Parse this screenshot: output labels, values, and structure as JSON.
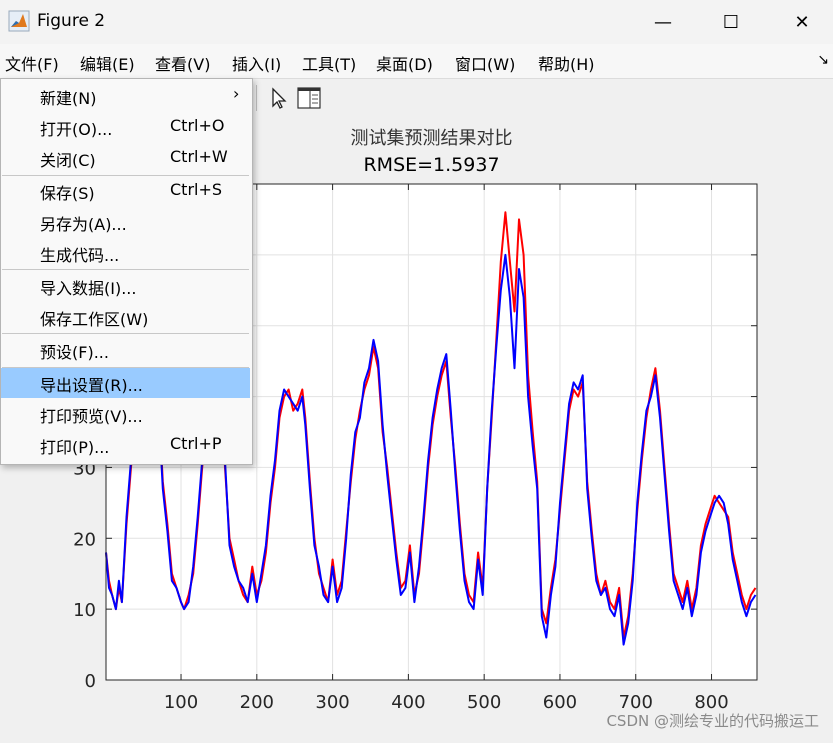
{
  "window": {
    "title": "Figure 2",
    "minimize_glyph": "—",
    "maximize_glyph": "☐",
    "close_glyph": "✕"
  },
  "menubar": {
    "items": [
      "文件(F)",
      "编辑(E)",
      "查看(V)",
      "插入(I)",
      "工具(T)",
      "桌面(D)",
      "窗口(W)",
      "帮助(H)"
    ],
    "overflow_glyph": "↘"
  },
  "toolbar": {
    "icons": [
      "pointer-icon",
      "property-inspector-icon"
    ]
  },
  "file_menu": {
    "items": [
      {
        "label": "新建(N)",
        "shortcut": "",
        "submenu": true
      },
      {
        "label": "打开(O)...",
        "shortcut": "Ctrl+O"
      },
      {
        "label": "关闭(C)",
        "shortcut": "Ctrl+W"
      },
      {
        "label": "保存(S)",
        "shortcut": "Ctrl+S"
      },
      {
        "label": "另存为(A)...",
        "shortcut": ""
      },
      {
        "label": "生成代码...",
        "shortcut": ""
      },
      {
        "label": "导入数据(I)...",
        "shortcut": ""
      },
      {
        "label": "保存工作区(W)",
        "shortcut": ""
      },
      {
        "label": "预设(F)...",
        "shortcut": ""
      },
      {
        "label": "导出设置(R)...",
        "shortcut": "",
        "highlighted": true
      },
      {
        "label": "打印预览(V)...",
        "shortcut": ""
      },
      {
        "label": "打印(P)...",
        "shortcut": "Ctrl+P"
      }
    ],
    "submenu_glyph": "›"
  },
  "chart_data": {
    "type": "line",
    "title": "测试集预测结果对比",
    "subtitle": "RMSE=1.5937",
    "xlabel": "",
    "ylabel": "",
    "xlim": [
      1,
      860
    ],
    "ylim": [
      0,
      70
    ],
    "xticks": [
      100,
      200,
      300,
      400,
      500,
      600,
      700,
      800
    ],
    "yticks_visible": [
      0,
      10,
      20,
      30
    ],
    "grid": true,
    "series": [
      {
        "color": "#ff0000",
        "x": [
          1,
          5,
          9,
          14,
          18,
          22,
          28,
          34,
          40,
          46,
          52,
          58,
          64,
          70,
          76,
          82,
          88,
          94,
          100,
          104,
          110,
          116,
          122,
          128,
          134,
          140,
          146,
          152,
          158,
          164,
          170,
          176,
          182,
          188,
          194,
          200,
          206,
          212,
          218,
          224,
          230,
          236,
          242,
          248,
          254,
          260,
          264,
          270,
          276,
          282,
          288,
          294,
          300,
          306,
          312,
          318,
          324,
          330,
          336,
          342,
          348,
          354,
          360,
          366,
          372,
          378,
          384,
          390,
          396,
          402,
          408,
          414,
          420,
          426,
          432,
          438,
          444,
          450,
          456,
          462,
          468,
          474,
          480,
          486,
          492,
          498,
          504,
          510,
          516,
          522,
          528,
          534,
          540,
          546,
          552,
          558,
          564,
          570,
          576,
          582,
          588,
          594,
          600,
          606,
          612,
          618,
          624,
          630,
          636,
          642,
          648,
          654,
          660,
          666,
          672,
          678,
          684,
          690,
          696,
          702,
          708,
          714,
          720,
          726,
          732,
          738,
          744,
          750,
          756,
          762,
          768,
          774,
          780,
          786,
          792,
          798,
          804,
          810,
          816,
          822,
          828,
          834,
          840,
          846,
          852,
          858
        ],
        "y": [
          18,
          14,
          12,
          10,
          13,
          11,
          22,
          30,
          37,
          42,
          45,
          44,
          43,
          40,
          28,
          22,
          15,
          13,
          11,
          10,
          12,
          15,
          22,
          30,
          37,
          42,
          44,
          43,
          30,
          20,
          17,
          14,
          12,
          11,
          16,
          12,
          14,
          18,
          25,
          30,
          37,
          40,
          41,
          38,
          39,
          41,
          37,
          28,
          20,
          15,
          13,
          11,
          17,
          12,
          14,
          21,
          28,
          34,
          38,
          41,
          43,
          47,
          44,
          35,
          30,
          24,
          18,
          13,
          14,
          19,
          12,
          15,
          22,
          30,
          36,
          40,
          43,
          45,
          37,
          30,
          22,
          15,
          12,
          11,
          18,
          13,
          27,
          37,
          48,
          59,
          66,
          59,
          52,
          65,
          60,
          43,
          35,
          28,
          10,
          8,
          13,
          17,
          24,
          31,
          38,
          41,
          40,
          42,
          28,
          21,
          15,
          12,
          14,
          11,
          10,
          13,
          6,
          9,
          15,
          24,
          31,
          37,
          41,
          44,
          38,
          30,
          22,
          15,
          13,
          11,
          14,
          10,
          13,
          19,
          22,
          24,
          26,
          25,
          24,
          23,
          18,
          15,
          12,
          10,
          12,
          13
        ]
      },
      {
        "color": "#0000ff",
        "x": [
          1,
          5,
          9,
          14,
          18,
          22,
          28,
          34,
          40,
          46,
          52,
          58,
          64,
          70,
          76,
          82,
          88,
          94,
          100,
          104,
          110,
          116,
          122,
          128,
          134,
          140,
          146,
          152,
          158,
          164,
          170,
          176,
          182,
          188,
          194,
          200,
          206,
          212,
          218,
          224,
          230,
          236,
          242,
          248,
          254,
          260,
          264,
          270,
          276,
          282,
          288,
          294,
          300,
          306,
          312,
          318,
          324,
          330,
          336,
          342,
          348,
          354,
          360,
          366,
          372,
          378,
          384,
          390,
          396,
          402,
          408,
          414,
          420,
          426,
          432,
          438,
          444,
          450,
          456,
          462,
          468,
          474,
          480,
          486,
          492,
          498,
          504,
          510,
          516,
          522,
          528,
          534,
          540,
          546,
          552,
          558,
          564,
          570,
          576,
          582,
          588,
          594,
          600,
          606,
          612,
          618,
          624,
          630,
          636,
          642,
          648,
          654,
          660,
          666,
          672,
          678,
          684,
          690,
          696,
          702,
          708,
          714,
          720,
          726,
          732,
          738,
          744,
          750,
          756,
          762,
          768,
          774,
          780,
          786,
          792,
          798,
          804,
          810,
          816,
          822,
          828,
          834,
          840,
          846,
          852,
          858
        ],
        "y": [
          18,
          13,
          12,
          10,
          14,
          11,
          23,
          31,
          37,
          41,
          44,
          43,
          42,
          39,
          27,
          21,
          14,
          13,
          11,
          10,
          11,
          16,
          23,
          31,
          38,
          43,
          45,
          44,
          31,
          19,
          16,
          14,
          13,
          11,
          15,
          11,
          15,
          19,
          26,
          31,
          38,
          41,
          40,
          39,
          38,
          40,
          36,
          27,
          19,
          16,
          12,
          11,
          16,
          11,
          13,
          20,
          29,
          35,
          37,
          42,
          44,
          48,
          45,
          36,
          29,
          23,
          17,
          12,
          13,
          18,
          11,
          16,
          23,
          31,
          37,
          41,
          44,
          46,
          38,
          29,
          21,
          14,
          11,
          10,
          17,
          12,
          27,
          38,
          47,
          55,
          60,
          54,
          44,
          58,
          54,
          40,
          33,
          27,
          9,
          6,
          12,
          16,
          25,
          32,
          39,
          42,
          41,
          43,
          27,
          20,
          14,
          12,
          13,
          10,
          9,
          12,
          5,
          8,
          14,
          25,
          32,
          38,
          40,
          43,
          37,
          29,
          21,
          14,
          12,
          10,
          13,
          9,
          12,
          18,
          21,
          23,
          25,
          26,
          25,
          22,
          17,
          14,
          11,
          9,
          11,
          12
        ]
      }
    ]
  },
  "watermark": "CSDN @测绘专业的代码搬运工"
}
